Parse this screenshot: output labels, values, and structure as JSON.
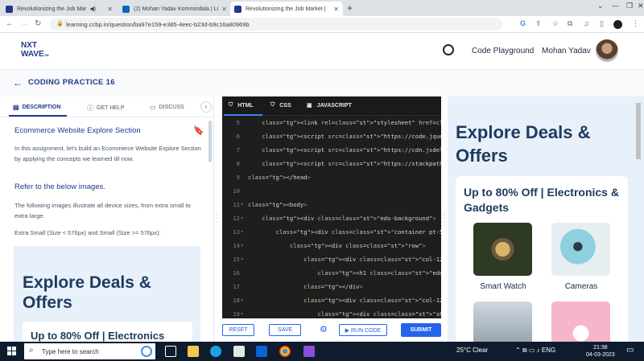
{
  "browser": {
    "tabs": [
      {
        "title": "Revolutionizing the Job Mar",
        "active": false
      },
      {
        "title": "(2) Mohan Yadav Kommindala | Li",
        "active": false
      },
      {
        "title": "Revolutionizing the Job Market |",
        "active": true
      }
    ],
    "url": "learning.ccbp.in/question/ba97e159-e385-4eec-b23d-b9c16a80969b"
  },
  "header": {
    "logo_line1": "NXT",
    "logo_line2": "WAVE",
    "logo_tm": "TM",
    "code_playground": "Code Playground",
    "username": "Mohan Yadav"
  },
  "practice": {
    "title": "CODING PRACTICE 16"
  },
  "left": {
    "tabs": {
      "description": "DESCRIPTION",
      "help": "GET HELP",
      "discuss": "DISCUSS"
    },
    "question_title": "Ecommerce Website Explore Section",
    "para1": "In this assignment, let's build an Ecommerce Website Explore Section by applying the concepts we learned till now.",
    "refer": "Refer to the below images.",
    "para2": "The following images illustrate all device sizes, from extra small to extra large.",
    "para3": "Extra Small (Size < 576px) and Small (Size >= 576px):",
    "preview_heading": "Explore Deals & Offers",
    "preview_card": "Up to 80% Off | Electronics"
  },
  "editor": {
    "tabs": {
      "html": "HTML",
      "css": "CSS",
      "js": "JAVASCRIPT"
    },
    "lines": [
      {
        "n": "5",
        "fold": "",
        "code": "    <link rel=\"stylesheet\" href=\"https://stac"
      },
      {
        "n": "6",
        "fold": "",
        "code": "    <script src=\"https://code.jquery.com/jque"
      },
      {
        "n": "7",
        "fold": "",
        "code": "    <script src=\"https://cdn.jsdelivr.net/npm"
      },
      {
        "n": "8",
        "fold": "",
        "code": "    <script src=\"https://stackpath.bootstrapc"
      },
      {
        "n": "9",
        "fold": "",
        "code": "</head>"
      },
      {
        "n": "10",
        "fold": "",
        "code": ""
      },
      {
        "n": "11",
        "fold": "▾",
        "code": "<body>"
      },
      {
        "n": "12",
        "fold": "▾",
        "code": "    <div class=\"edo-background\">"
      },
      {
        "n": "13",
        "fold": "▾",
        "code": "        <div class=\"container pt-5 pb-5\">"
      },
      {
        "n": "14",
        "fold": "▾",
        "code": "            <div class=\"row\">"
      },
      {
        "n": "15",
        "fold": "▾",
        "code": "                <div class=\"col-12 mb-3\">"
      },
      {
        "n": "16",
        "fold": "",
        "code": "                    <h1 class=\"edo-heading\">E"
      },
      {
        "n": "17",
        "fold": "",
        "code": "                </div>"
      },
      {
        "n": "18",
        "fold": "▾",
        "code": "                <div class=\"col-12 col-md-6 c"
      },
      {
        "n": "19",
        "fold": "▾",
        "code": "                    <div class=\"shadow edo-ca"
      }
    ],
    "buttons": {
      "reset": "RESET",
      "save": "SAVE",
      "run": "▶ RUN CODE",
      "submit": "SUBMIT"
    }
  },
  "preview": {
    "heading": "Explore Deals & Offers",
    "card_title": "Up to 80% Off | Electronics & Gadgets",
    "products": [
      {
        "label": "Smart Watch",
        "color": "#3a3f2a"
      },
      {
        "label": "Cameras",
        "color": "#9fd8e8"
      },
      {
        "label": "",
        "color": "#b8c4cf"
      },
      {
        "label": "",
        "color": "#f4b6c8"
      }
    ]
  },
  "taskbar": {
    "search_placeholder": "Type here to search",
    "weather": "25°C  Clear",
    "lang": "ENG",
    "time": "21:38",
    "date": "04-03-2023"
  },
  "colors": {
    "brand": "#1e3a8a",
    "accent": "#2563eb",
    "preview_bg": "#e8f1fa",
    "editor_bg": "#1e1e1e"
  }
}
